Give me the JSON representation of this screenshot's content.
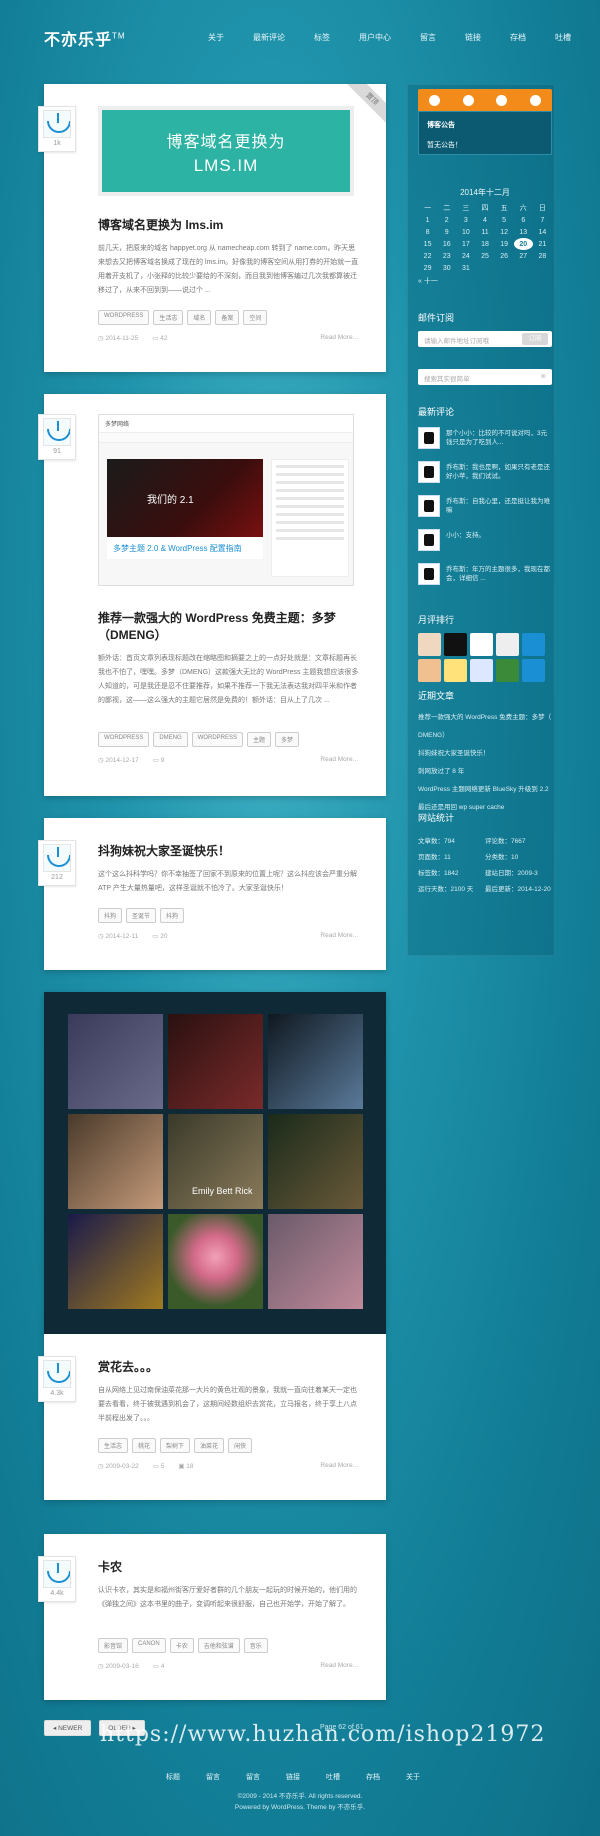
{
  "site": {
    "logo": "不亦乐乎",
    "logo_mark": "TM"
  },
  "nav": [
    "关于",
    "最新评论",
    "标签",
    "用户中心",
    "留言",
    "链接",
    "存档",
    "吐槽"
  ],
  "posts": [
    {
      "title": "博客域名更换为 lms.im",
      "banner_line1": "博客域名更换为",
      "banner_line2": "LMS.IM",
      "ribbon": "置顶",
      "excerpt": "前几天，把原来的域名 happyet.org 从 namecheap.com 转到了 name.com，昨天思来想去又把博客域名换成了现在的 lms.im。好像我的博客空间从用打券的开始就一直用着开支机了，小张释的比较少要给的不深刻，而且我到他博客编过几次我都算被迁移过了，从来不回到到——说过个 ...",
      "tags": [
        "WORDPRESS",
        "生活志",
        "域名",
        "备案",
        "空间"
      ],
      "date": "2014-11-25",
      "comments": "42",
      "readmore": "Read More...",
      "count": "1k"
    },
    {
      "title": "推荐一款强大的 WordPress 免费主题：多梦（DMENG）",
      "excerpt": "额外话：首页文章列表现标题改在缩略图和摘要之上的一点好处就是：文章标题再长我也不怕了，嘿嘿。多梦（DMENG）这款强大无比的 WordPress 主题我想应该很多人知道的，可是我还是忍不住要推荐，如果不推荐一下我无法表达我对四平米和作者的鄙视，这——这么强大的主题它居然是免费的！额外话：目从上了几次 ...",
      "tags": [
        "WORDPRESS",
        "DMENG",
        "WORDPRESS",
        "主题",
        "多梦"
      ],
      "date": "2014-12-17",
      "comments": "9",
      "readmore": "Read More...",
      "count": "91",
      "shot_site": "多梦网络",
      "shot_slide": "我们的 2.1",
      "shot_caption": "多梦主题 2.0 & WordPress 配置指南"
    },
    {
      "title": "抖狗妹祝大家圣诞快乐！",
      "excerpt": "这个这么抖科学吗？你不幸抽签了回家不到原来的位置上呢？这么抖应该会严重分解 ATP 产生大量热量吧，这样圣诞就不怕冷了。大家圣诞快乐！",
      "tags": [
        "抖狗",
        "圣诞节",
        "抖狗"
      ],
      "date": "2014-12-11",
      "comments": "20",
      "readmore": "Read More...",
      "count": "212"
    },
    {
      "title": "赏花去。。。",
      "excerpt": "自从网络上见过南保油菜花那一大片的黄色壮观的景象，我就一直向往着某天一定也要去看看，终于被我遇到机会了，这期间经数组织去赏花，立马报名，终于享上八点半前程出发了。。。",
      "tags": [
        "生活志",
        "桃花",
        "梨树下",
        "油菜花",
        "闲侠"
      ],
      "date": "2009-03-22",
      "comments": "5",
      "photos": "18",
      "readmore": "Read More...",
      "count": "4.3k",
      "gallery_text": "Emily Bett Rick"
    },
    {
      "title": "卡农",
      "excerpt": "认识卡农，其实是和福州街客厅爱好者群的几个朋友一起玩的时候开始的，他们用的《弹独之间》这本书里的曲子，变调听起来很舒服，自己也开始学，开始了解了。",
      "tags": [
        "影音馆",
        "CANON",
        "卡农",
        "吉他和弦谱",
        "音乐"
      ],
      "date": "2009-03-16",
      "comments": "4",
      "readmore": "Read More...",
      "count": "4.4k"
    }
  ],
  "sidebar": {
    "notice_title": "博客公告",
    "notice_text": "暂无公告！",
    "calendar_title": "2014年十二月",
    "calendar_head": [
      "一",
      "二",
      "三",
      "四",
      "五",
      "六",
      "日"
    ],
    "calendar_rows": [
      [
        "1",
        "2",
        "3",
        "4",
        "5",
        "6",
        "7"
      ],
      [
        "8",
        "9",
        "10",
        "11",
        "12",
        "13",
        "14"
      ],
      [
        "15",
        "16",
        "17",
        "18",
        "19",
        "20",
        "21"
      ],
      [
        "22",
        "23",
        "24",
        "25",
        "26",
        "27",
        "28"
      ],
      [
        "29",
        "30",
        "31",
        "",
        "",
        "",
        ""
      ]
    ],
    "calendar_today": "20",
    "calendar_prev": "« 十一",
    "subscribe_title": "邮件订阅",
    "subscribe_placeholder": "请输入邮件地址订阅哦",
    "subscribe_button": "订阅",
    "search_placeholder": "搜索其实很简单",
    "comments_title": "最新评论",
    "comments": [
      "那个小小：比较的不可说对吗，3元钱只是为了吃到人...",
      "乔布斯：我也是啊，如果只有老是还好小苹，我们试试。",
      "乔布斯：自我心里，还是挺让我为难嘛",
      "小小：支持。",
      "乔布斯：年万的主题很多，我现在都会，详细信 ..."
    ],
    "monthly_title": "月评排行",
    "recent_title": "近期文章",
    "recent": [
      "推荐一款强大的 WordPress 免费主题：多梦（",
      "DMENG）",
      "抖狗妹祝大家圣诞快乐！",
      "刺网放过了 8 年",
      "WordPress 主题网络更新 BlueSky 升级到 2.2",
      "最后还是用回 wp super cache"
    ],
    "stats_title": "网站统计",
    "stats": [
      "文章数：794",
      "评论数：7667",
      "页面数：11",
      "分类数：10",
      "标签数：1842",
      "建站日期：2009-3",
      "运行天数：2100 天",
      "最后更新：2014-12-20"
    ]
  },
  "pager": {
    "newer": "◂ NEWER",
    "older": "OLDER ▸",
    "info": "Page 62 of 61"
  },
  "footer": {
    "nav": [
      "标题",
      "留言",
      "留言",
      "链接",
      "吐槽",
      "存档",
      "关于"
    ],
    "line1": "©2009 - 2014 不亦乐乎. All rights reserved.",
    "line2": "Powered by WordPress. Theme by 不亦乐乎."
  },
  "watermark": "https://www.huzhan.com/ishop21972",
  "colors": {
    "accent": "#1b8fd3",
    "teal_banner": "#2cb3a3",
    "social_bar": "#f38b1b"
  }
}
